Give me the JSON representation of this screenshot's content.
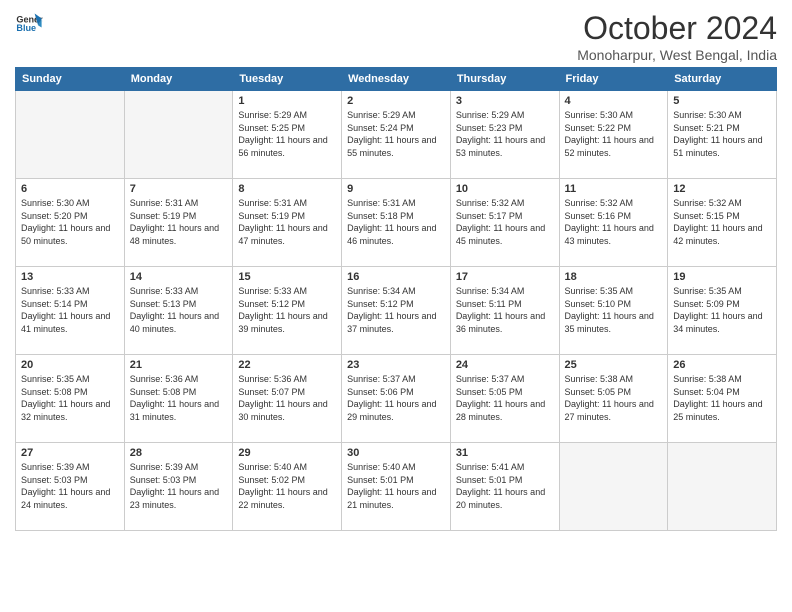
{
  "logo": {
    "line1": "General",
    "line2": "Blue"
  },
  "title": "October 2024",
  "location": "Monoharpur, West Bengal, India",
  "weekdays": [
    "Sunday",
    "Monday",
    "Tuesday",
    "Wednesday",
    "Thursday",
    "Friday",
    "Saturday"
  ],
  "weeks": [
    [
      {
        "day": "",
        "empty": true
      },
      {
        "day": "",
        "empty": true
      },
      {
        "day": "1",
        "sunrise": "5:29 AM",
        "sunset": "5:25 PM",
        "daylight": "11 hours and 56 minutes."
      },
      {
        "day": "2",
        "sunrise": "5:29 AM",
        "sunset": "5:24 PM",
        "daylight": "11 hours and 55 minutes."
      },
      {
        "day": "3",
        "sunrise": "5:29 AM",
        "sunset": "5:23 PM",
        "daylight": "11 hours and 53 minutes."
      },
      {
        "day": "4",
        "sunrise": "5:30 AM",
        "sunset": "5:22 PM",
        "daylight": "11 hours and 52 minutes."
      },
      {
        "day": "5",
        "sunrise": "5:30 AM",
        "sunset": "5:21 PM",
        "daylight": "11 hours and 51 minutes."
      }
    ],
    [
      {
        "day": "6",
        "sunrise": "5:30 AM",
        "sunset": "5:20 PM",
        "daylight": "11 hours and 50 minutes."
      },
      {
        "day": "7",
        "sunrise": "5:31 AM",
        "sunset": "5:19 PM",
        "daylight": "11 hours and 48 minutes."
      },
      {
        "day": "8",
        "sunrise": "5:31 AM",
        "sunset": "5:19 PM",
        "daylight": "11 hours and 47 minutes."
      },
      {
        "day": "9",
        "sunrise": "5:31 AM",
        "sunset": "5:18 PM",
        "daylight": "11 hours and 46 minutes."
      },
      {
        "day": "10",
        "sunrise": "5:32 AM",
        "sunset": "5:17 PM",
        "daylight": "11 hours and 45 minutes."
      },
      {
        "day": "11",
        "sunrise": "5:32 AM",
        "sunset": "5:16 PM",
        "daylight": "11 hours and 43 minutes."
      },
      {
        "day": "12",
        "sunrise": "5:32 AM",
        "sunset": "5:15 PM",
        "daylight": "11 hours and 42 minutes."
      }
    ],
    [
      {
        "day": "13",
        "sunrise": "5:33 AM",
        "sunset": "5:14 PM",
        "daylight": "11 hours and 41 minutes."
      },
      {
        "day": "14",
        "sunrise": "5:33 AM",
        "sunset": "5:13 PM",
        "daylight": "11 hours and 40 minutes."
      },
      {
        "day": "15",
        "sunrise": "5:33 AM",
        "sunset": "5:12 PM",
        "daylight": "11 hours and 39 minutes."
      },
      {
        "day": "16",
        "sunrise": "5:34 AM",
        "sunset": "5:12 PM",
        "daylight": "11 hours and 37 minutes."
      },
      {
        "day": "17",
        "sunrise": "5:34 AM",
        "sunset": "5:11 PM",
        "daylight": "11 hours and 36 minutes."
      },
      {
        "day": "18",
        "sunrise": "5:35 AM",
        "sunset": "5:10 PM",
        "daylight": "11 hours and 35 minutes."
      },
      {
        "day": "19",
        "sunrise": "5:35 AM",
        "sunset": "5:09 PM",
        "daylight": "11 hours and 34 minutes."
      }
    ],
    [
      {
        "day": "20",
        "sunrise": "5:35 AM",
        "sunset": "5:08 PM",
        "daylight": "11 hours and 32 minutes."
      },
      {
        "day": "21",
        "sunrise": "5:36 AM",
        "sunset": "5:08 PM",
        "daylight": "11 hours and 31 minutes."
      },
      {
        "day": "22",
        "sunrise": "5:36 AM",
        "sunset": "5:07 PM",
        "daylight": "11 hours and 30 minutes."
      },
      {
        "day": "23",
        "sunrise": "5:37 AM",
        "sunset": "5:06 PM",
        "daylight": "11 hours and 29 minutes."
      },
      {
        "day": "24",
        "sunrise": "5:37 AM",
        "sunset": "5:05 PM",
        "daylight": "11 hours and 28 minutes."
      },
      {
        "day": "25",
        "sunrise": "5:38 AM",
        "sunset": "5:05 PM",
        "daylight": "11 hours and 27 minutes."
      },
      {
        "day": "26",
        "sunrise": "5:38 AM",
        "sunset": "5:04 PM",
        "daylight": "11 hours and 25 minutes."
      }
    ],
    [
      {
        "day": "27",
        "sunrise": "5:39 AM",
        "sunset": "5:03 PM",
        "daylight": "11 hours and 24 minutes."
      },
      {
        "day": "28",
        "sunrise": "5:39 AM",
        "sunset": "5:03 PM",
        "daylight": "11 hours and 23 minutes."
      },
      {
        "day": "29",
        "sunrise": "5:40 AM",
        "sunset": "5:02 PM",
        "daylight": "11 hours and 22 minutes."
      },
      {
        "day": "30",
        "sunrise": "5:40 AM",
        "sunset": "5:01 PM",
        "daylight": "11 hours and 21 minutes."
      },
      {
        "day": "31",
        "sunrise": "5:41 AM",
        "sunset": "5:01 PM",
        "daylight": "11 hours and 20 minutes."
      },
      {
        "day": "",
        "empty": true
      },
      {
        "day": "",
        "empty": true
      }
    ]
  ]
}
